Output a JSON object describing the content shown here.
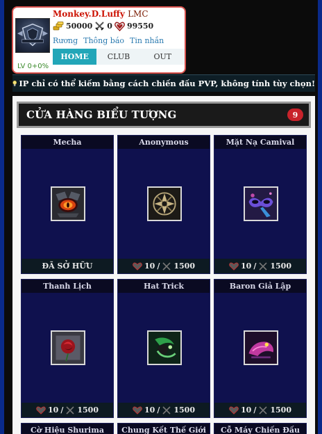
{
  "profile": {
    "name": "Monkey.D.Luffy",
    "clan": "LMC",
    "gold": "50000",
    "swords": "0",
    "gems": "99550",
    "level": "LV 0+0%",
    "links": [
      "Rương",
      "Thông báo",
      "Tin nhắn"
    ],
    "tabs": [
      "HOME",
      "CLUB",
      "OUT"
    ],
    "active_tab": "HOME"
  },
  "info_bar": {
    "text": "IP chỉ có thể kiếm bằng cách chiến đấu PVP, không tính tùy chọn!"
  },
  "shop": {
    "title": "CỬA HÀNG BIỂU TƯỢNG",
    "count": "9",
    "items": [
      {
        "name": "Mecha",
        "status": "ĐÃ SỞ HỮU",
        "owned": true,
        "icon": "mecha-eye-icon",
        "accent": "#c0392b"
      },
      {
        "name": "Anonymous",
        "gem_price": "10",
        "sword_price": "1500",
        "owned": false,
        "icon": "anonymous-crest-icon",
        "accent": "#b8a77a"
      },
      {
        "name": "Mặt Nạ Camival",
        "gem_price": "10",
        "sword_price": "1500",
        "owned": false,
        "icon": "carnival-mask-icon",
        "accent": "#6b4fd8"
      },
      {
        "name": "Thanh Lịch",
        "gem_price": "10",
        "sword_price": "1500",
        "owned": false,
        "icon": "rose-icon",
        "accent": "#b8232b"
      },
      {
        "name": "Hat Trick",
        "gem_price": "10",
        "sword_price": "1500",
        "owned": false,
        "icon": "hat-trick-icon",
        "accent": "#2ea04a"
      },
      {
        "name": "Baron Giả Lập",
        "gem_price": "10",
        "sword_price": "1500",
        "owned": false,
        "icon": "baron-icon",
        "accent": "#c03aa0"
      },
      {
        "name": "Cờ Hiệu Shurima",
        "owned": false,
        "icon": "shurima-icon"
      },
      {
        "name": "Chung Kết Thế Giới",
        "owned": false,
        "icon": "worlds-icon"
      },
      {
        "name": "Cỗ Máy Chiến Đấu",
        "owned": false,
        "icon": "war-machine-icon"
      }
    ]
  }
}
